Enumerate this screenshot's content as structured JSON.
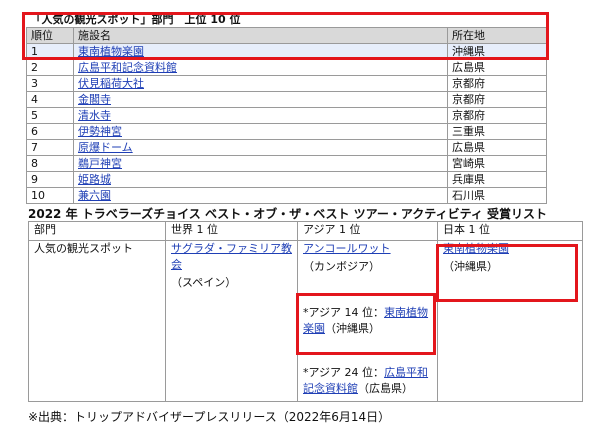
{
  "ranking": {
    "title": "「人気の観光スポット」部門　上位 10 位",
    "headers": {
      "rank": "順位",
      "name": "施設名",
      "location": "所在地"
    },
    "rows": [
      {
        "rank": "1",
        "name": "東南植物楽園",
        "location": "沖縄県"
      },
      {
        "rank": "2",
        "name": "広島平和記念資料館",
        "location": "広島県"
      },
      {
        "rank": "3",
        "name": "伏見稲荷大社",
        "location": "京都府"
      },
      {
        "rank": "4",
        "name": "金閣寺",
        "location": "京都府"
      },
      {
        "rank": "5",
        "name": "清水寺",
        "location": "京都府"
      },
      {
        "rank": "6",
        "name": "伊勢神宮",
        "location": "三重県"
      },
      {
        "rank": "7",
        "name": "原爆ドーム",
        "location": "広島県"
      },
      {
        "rank": "8",
        "name": "鵜戸神宮",
        "location": "宮崎県"
      },
      {
        "rank": "9",
        "name": "姫路城",
        "location": "兵庫県"
      },
      {
        "rank": "10",
        "name": "兼六園",
        "location": "石川県"
      }
    ]
  },
  "awards": {
    "title": "2022 年 トラベラーズチョイス ベスト・オブ・ザ・ベスト ツアー・アクティビティ 受賞リスト",
    "headers": {
      "category": "部門",
      "world": "世界 1 位",
      "asia": "アジア 1 位",
      "japan": "日本 1 位"
    },
    "row": {
      "category": "人気の観光スポット",
      "world_name": "サグラダ・ファミリア教会",
      "world_sub": "（スペイン）",
      "asia_name": "アンコールワット",
      "asia_sub": "（カンボジア）",
      "japan_name": "東南植物楽園",
      "japan_sub": "（沖縄県）",
      "asia14_prefix": "*アジア 14 位：",
      "asia14_name": "東南植物楽園",
      "asia14_sub": "（沖縄県）",
      "asia24_prefix": "*アジア 24 位：",
      "asia24_name": "広島平和記念資料館",
      "asia24_sub": "（広島県）"
    }
  },
  "source": "※出典：トリップアドバイザープレスリリース（2022年6月14日）",
  "colors": {
    "highlight": "#e3161c",
    "link": "#1f3fb5",
    "header_bg": "#d9d9d9",
    "first_row_bg": "#e7eefb"
  }
}
